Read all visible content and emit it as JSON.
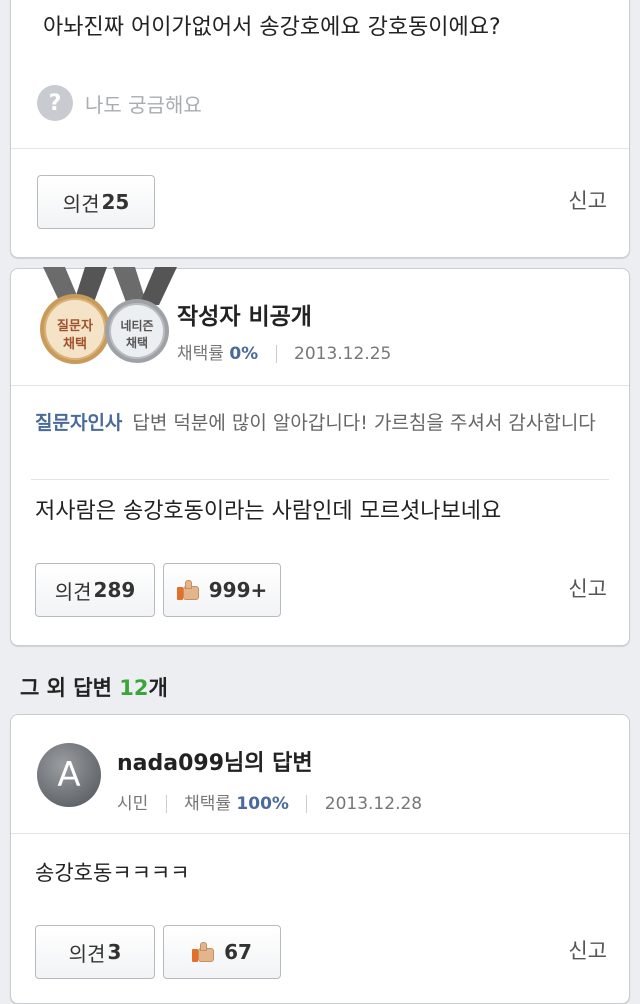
{
  "top_card": {
    "question_text": "아놔진짜 어이가없어서 송강호에요 강호동이에요?",
    "curious_label": "나도 궁금해요",
    "opinion_label": "의견",
    "opinion_count": "25",
    "report_label": "신고"
  },
  "answer_card": {
    "badge_left": {
      "line1": "질문자",
      "line2": "채택"
    },
    "badge_right": {
      "line1": "네티즌",
      "line2": "채택"
    },
    "author": "작성자 비공개",
    "adopt_rate_label": "채택률",
    "adopt_rate_value": "0%",
    "date": "2013.12.25",
    "greeting_label": "질문자인사",
    "greeting_text": "답변 덕분에 많이 알아갑니다! 가르침을 주셔서 감사합니다",
    "answer_text": "저사람은 송강호동이라는 사람인데 모르셧나보네요",
    "opinion_label": "의견",
    "opinion_count": "289",
    "like_count": "999+",
    "report_label": "신고"
  },
  "other_answers": {
    "heading_prefix": "그 외 답변",
    "count": "12",
    "heading_suffix": "개"
  },
  "second_answer": {
    "avatar_letter": "A",
    "author_title": "nada099님의 답변",
    "level": "시민",
    "adopt_rate_label": "채택률",
    "adopt_rate_value": "100%",
    "date": "2013.12.28",
    "answer_text": "송강호동ㅋㅋㅋㅋ",
    "opinion_label": "의견",
    "opinion_count": "3",
    "like_count": "67",
    "report_label": "신고"
  },
  "colors": {
    "accent_blue": "#4a6b9a",
    "count_green": "#3aa63a",
    "background": "#eceef1"
  },
  "icons": [
    "question-circle-icon",
    "thumbs-up-icon",
    "medal-icon",
    "avatar-icon"
  ]
}
